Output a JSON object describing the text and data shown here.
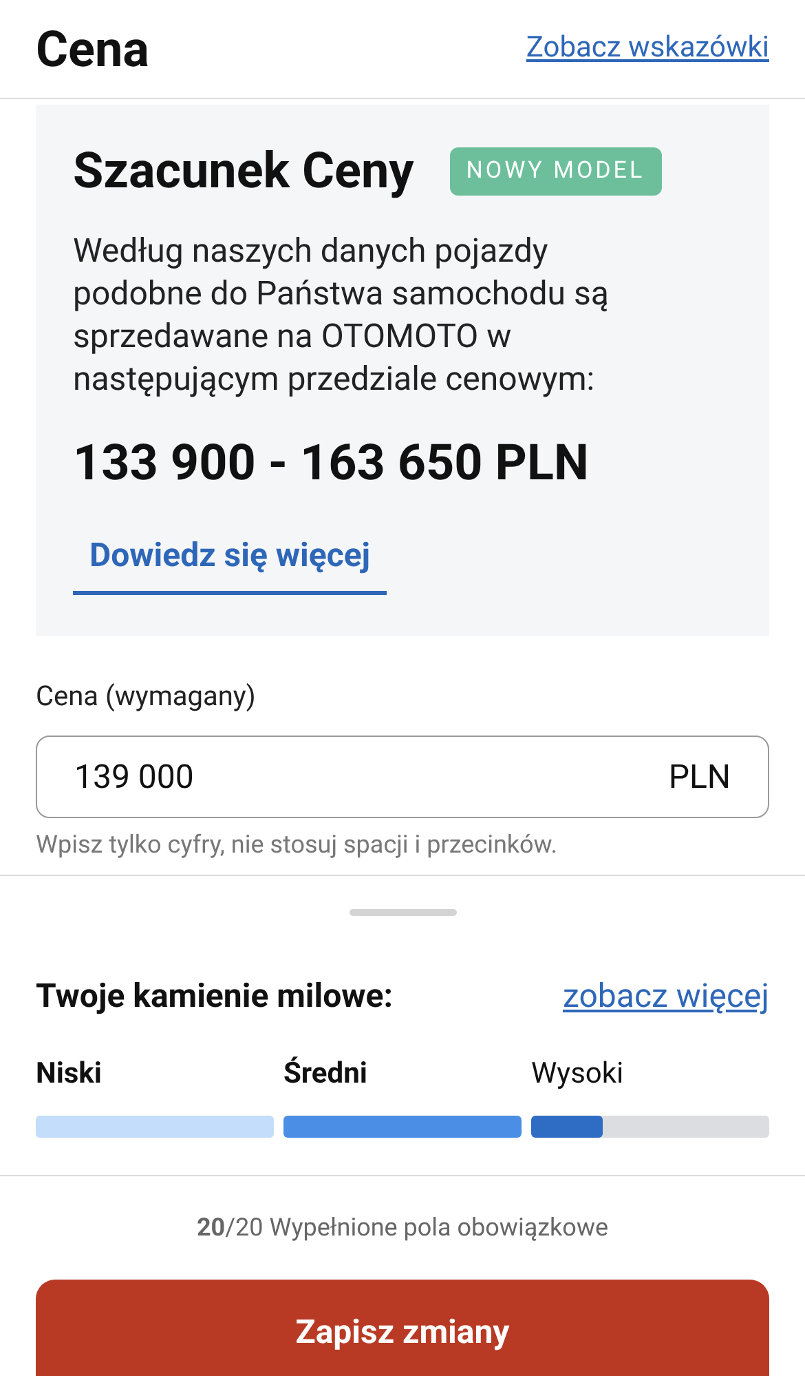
{
  "header": {
    "title": "Cena",
    "link": "Zobacz wskazówki"
  },
  "estimate": {
    "title": "Szacunek Ceny",
    "badge": "NOWY MODEL",
    "description": "Według naszych danych pojazdy podobne do Państwa samochodu są sprzedawane na OTOMOTO w następującym przedziale cenowym:",
    "range": "133 900 - 163 650 PLN",
    "link": "Dowiedz się więcej"
  },
  "price_field": {
    "label": "Cena (wymagany)",
    "value": "139 000",
    "unit": "PLN",
    "hint": "Wpisz tylko cyfry, nie stosuj spacji i przecinków."
  },
  "milestones": {
    "title": "Twoje kamienie milowe:",
    "link": "zobacz więcej",
    "levels": [
      {
        "label": "Niski",
        "bold": true,
        "level": 1,
        "color": "#c3ddfb"
      },
      {
        "label": "Średni",
        "bold": true,
        "level": 1,
        "color": "#4a8ee6"
      },
      {
        "label": "Wysoki",
        "bold": false,
        "level": 0.3,
        "color": "#2f6cc4"
      }
    ]
  },
  "progress": {
    "count": "20",
    "total": "/20 Wypełnione pola obowiązkowe"
  },
  "save_button": "Zapisz zmiany"
}
